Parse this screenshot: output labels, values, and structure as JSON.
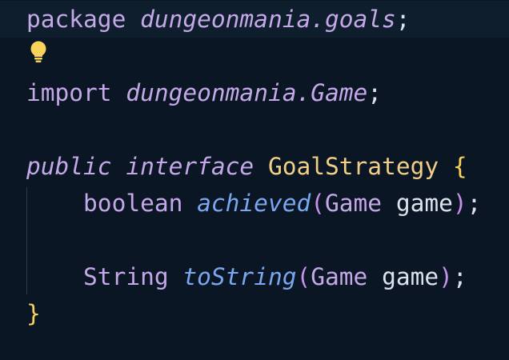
{
  "code": {
    "line1": {
      "keyword": "package",
      "package_name": "dungeonmania.goals",
      "semicolon": ";"
    },
    "line3": {
      "keyword": "import",
      "import_path": "dungeonmania.Game",
      "semicolon": ";"
    },
    "line5": {
      "modifier": "public",
      "keyword": "interface",
      "type_name": "GoalStrategy",
      "open_brace": "{"
    },
    "line6": {
      "return_type": "boolean",
      "method": "achieved",
      "open_paren": "(",
      "param_type": "Game",
      "param_name": "game",
      "close_paren": ")",
      "semicolon": ";"
    },
    "line8": {
      "return_type": "String",
      "method": "toString",
      "open_paren": "(",
      "param_type": "Game",
      "param_name": "game",
      "close_paren": ")",
      "semicolon": ";"
    },
    "line9": {
      "close_brace": "}"
    }
  },
  "icons": {
    "lightbulb": "lightbulb-icon"
  },
  "colors": {
    "background": "#0a1624",
    "keyword": "#c4a8e8",
    "function": "#7aa7ef",
    "type": "#f1cf87",
    "brace": "#f8d25b",
    "lightbulb": "#f8d25b"
  }
}
